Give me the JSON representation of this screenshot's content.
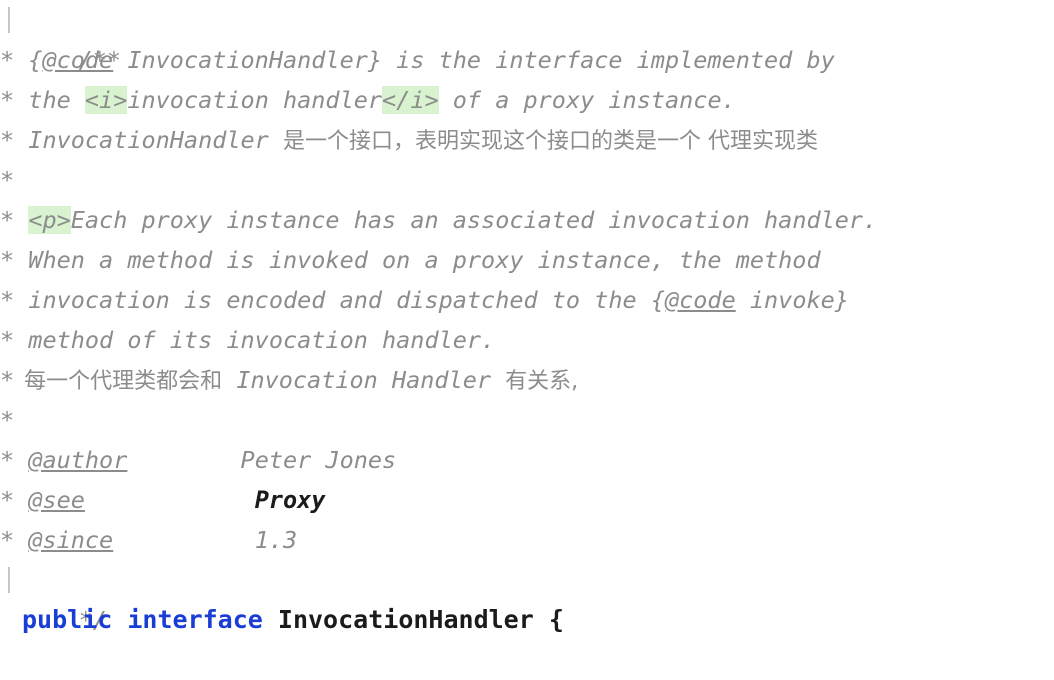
{
  "editor": {
    "language": "java",
    "colors": {
      "background": "#ffffff",
      "comment": "#8c8c8c",
      "keyword": "#1a3dd6",
      "identifier": "#1b1b1b",
      "tag_highlight_bg": "#d9f2d0",
      "fold_guide": "#c8c8c8"
    }
  },
  "code": {
    "line01": {
      "open": "/**"
    },
    "line02": {
      "ast": "*",
      "pre": " {",
      "tag": "@code",
      "post": " InvocationHandler} is the interface implemented by"
    },
    "line03": {
      "ast": "*",
      "pre": " the ",
      "tag_open": "<i>",
      "mid": "invocation handler",
      "tag_close": "</i>",
      "post": " of a proxy instance."
    },
    "line04": {
      "ast": "*",
      "text_en": " InvocationHandler ",
      "text_cjk": "是一个接口，表明实现这个接口的类是一个 代理实现类"
    },
    "line05": {
      "ast": "*"
    },
    "line06": {
      "ast": "*",
      "pre": " ",
      "tag_open": "<p>",
      "post": "Each proxy instance has an associated invocation handler."
    },
    "line07": {
      "ast": "*",
      "text": " When a method is invoked on a proxy instance, the method"
    },
    "line08": {
      "ast": "*",
      "pre": " invocation is encoded and dispatched to the {",
      "tag": "@code",
      "post": " invoke}"
    },
    "line09": {
      "ast": "*",
      "text": " method of its invocation handler."
    },
    "line10": {
      "ast": "*",
      "text_cjk": "每一个代理类都会和",
      "text_en": " Invocation Handler ",
      "text_cjk2": "有关系,"
    },
    "line11": {
      "ast": "*"
    },
    "line12": {
      "ast": "*",
      "tag": "@author",
      "gap": "        ",
      "value": "Peter Jones"
    },
    "line13": {
      "ast": "*",
      "tag": "@see",
      "gap": "            ",
      "value": "Proxy"
    },
    "line14": {
      "ast": "*",
      "tag": "@since",
      "gap": "          ",
      "value": "1.3"
    },
    "line15": {
      "close": "*/"
    },
    "line16": {
      "kw1": "public",
      "sp1": " ",
      "kw2": "interface",
      "sp2": " ",
      "name": "InvocationHandler",
      "sp3": " ",
      "brace": "{"
    }
  }
}
